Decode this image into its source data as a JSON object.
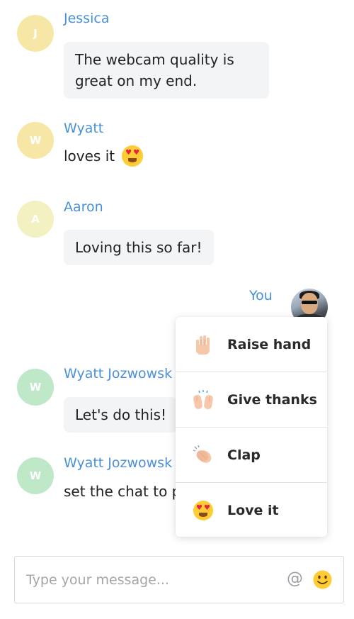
{
  "messages": [
    {
      "initial": "J",
      "name": "Jessica",
      "text": "The webcam quality is great on my end.",
      "avatar_color": "#f7e7a6"
    },
    {
      "initial": "W",
      "name": "Wyatt",
      "text": "loves it",
      "avatar_color": "#f7e7a6"
    },
    {
      "initial": "A",
      "name": "Aaron",
      "text": "Loving this so far!",
      "avatar_color": "#f3f0c2"
    },
    {
      "initial": "W",
      "name": "Wyatt Jozwowsk",
      "text": "Let's do this!",
      "avatar_color": "#bfe8c9"
    },
    {
      "initial": "W",
      "name": "Wyatt Jozwowsk",
      "text": "set the chat to pr",
      "avatar_color": "#bfe8c9"
    }
  ],
  "self": {
    "name": "You"
  },
  "reaction_menu": {
    "items": [
      {
        "label": "Raise hand",
        "icon": "raised-hand-icon"
      },
      {
        "label": "Give thanks",
        "icon": "raising-hands-icon"
      },
      {
        "label": "Clap",
        "icon": "clapping-hands-icon"
      },
      {
        "label": "Love it",
        "icon": "heart-eyes-icon"
      }
    ]
  },
  "composer": {
    "placeholder": "Type your message...",
    "mention_icon": "at-icon",
    "emoji_icon": "smile-icon"
  },
  "colors": {
    "name_blue": "#4a90d9",
    "bubble_bg": "#f3f4f6",
    "emoji_yellow": "#ffcc33",
    "skin": "#f6c7a8"
  }
}
